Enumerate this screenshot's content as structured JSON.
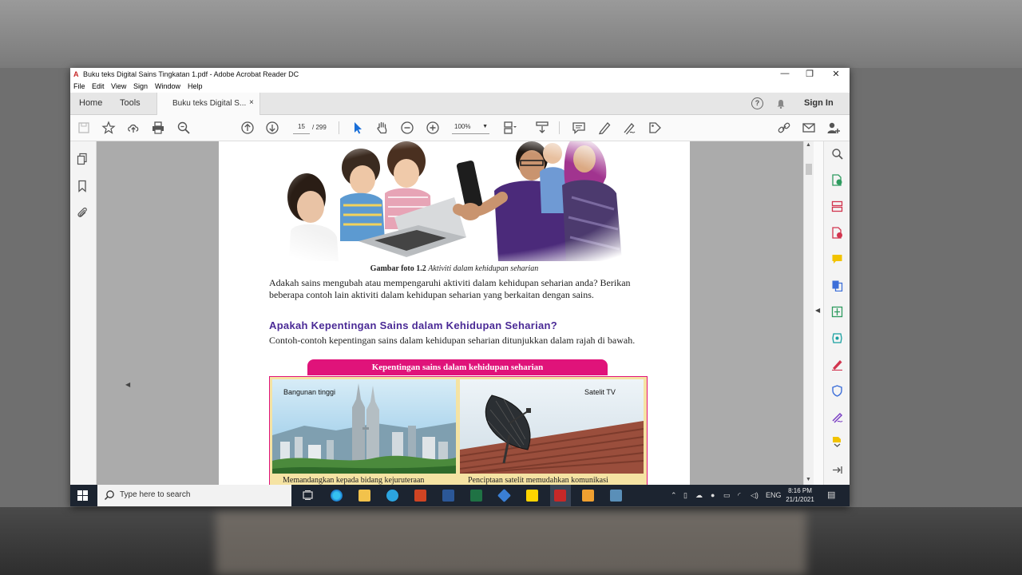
{
  "window": {
    "title": "Buku teks Digital Sains Tingkatan 1.pdf - Adobe Acrobat Reader DC",
    "controls": {
      "minimize": "—",
      "restore": "❐",
      "close": "✕"
    }
  },
  "menu": [
    "File",
    "Edit",
    "View",
    "Sign",
    "Window",
    "Help"
  ],
  "tabs": {
    "home": "Home",
    "tools": "Tools",
    "document": "Buku teks Digital S...",
    "close": "×",
    "sign_in": "Sign In",
    "help": "?"
  },
  "toolbar": {
    "current_page": "15",
    "total_pages": "/ 299",
    "zoom": "100%"
  },
  "page": {
    "caption_bold": "Gambar foto 1.2",
    "caption_italic": "Aktiviti dalam kehidupan seharian",
    "para1": "Adakah sains mengubah atau mempengaruhi aktiviti dalam kehidupan seharian anda? Berikan beberapa contoh lain aktiviti dalam kehidupan seharian yang berkaitan dengan sains.",
    "heading": "Apakah Kepentingan Sains dalam Kehidupan Seharian?",
    "para2": "Contoh-contoh kepentingan sains dalam kehidupan seharian ditunjukkan dalam rajah di bawah.",
    "banner": "Kepentingan sains dalam kehidupan seharian",
    "cell1_label": "Bangunan tinggi",
    "cell2_label": "Satelit TV",
    "cell1_desc": "Memandangkan kepada bidang kejuruteraan",
    "cell2_desc": "Penciptaan satelit memudahkan komunikasi"
  },
  "taskbar": {
    "search_placeholder": "Type here to search",
    "language": "ENG",
    "time": "8:16 PM",
    "date": "21/1/2021"
  }
}
